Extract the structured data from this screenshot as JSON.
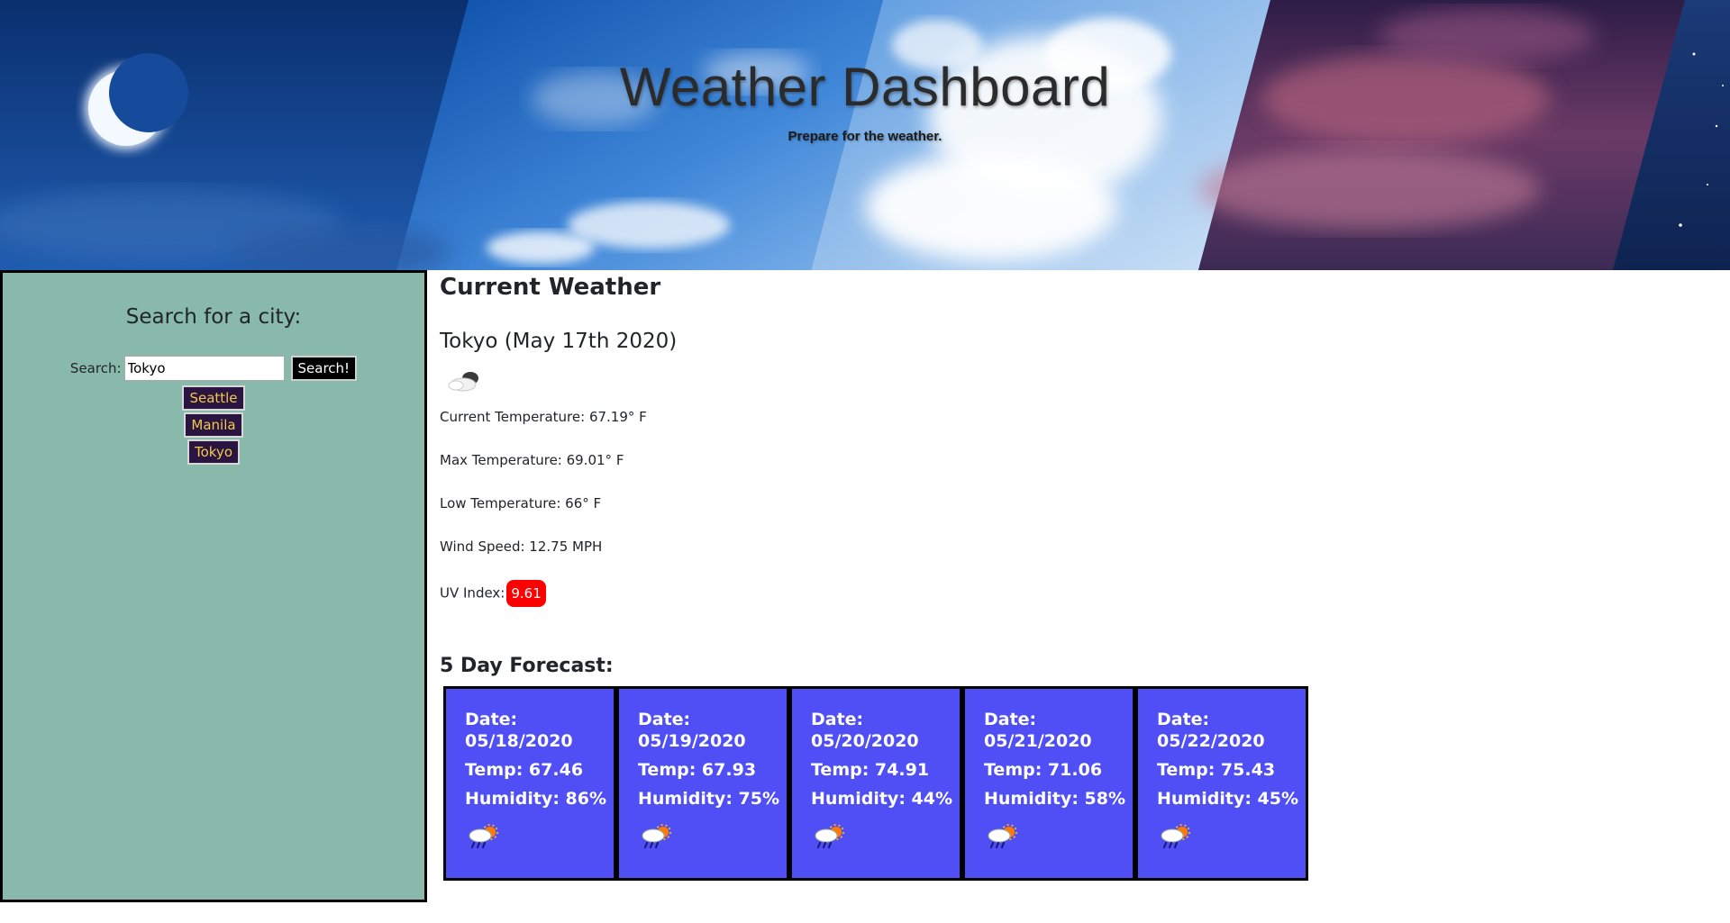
{
  "header": {
    "title": "Weather Dashboard",
    "subtitle": "Prepare for the weather."
  },
  "sidebar": {
    "title": "Search for a city:",
    "search_label": "Search:",
    "search_value": "Tokyo",
    "search_button": "Search!",
    "history": [
      "Seattle",
      "Manila",
      "Tokyo"
    ]
  },
  "current": {
    "heading": "Current Weather",
    "city": "Tokyo (May 17th 2020)",
    "icon": "cloud-icon",
    "temp": "Current Temperature: 67.19° F",
    "max": "Max Temperature: 69.01° F",
    "low": "Low Temperature: 66° F",
    "wind": "Wind Speed: 12.75 MPH",
    "uv_label": "UV Index:",
    "uv_value": "9.61"
  },
  "forecast": {
    "heading": "5 Day Forecast:",
    "date_label": "Date:",
    "days": [
      {
        "date": "05/18/2020",
        "temp": "Temp: 67.46",
        "humidity": "Humidity: 86%",
        "icon": "rain-sun-icon"
      },
      {
        "date": "05/19/2020",
        "temp": "Temp: 67.93",
        "humidity": "Humidity: 75%",
        "icon": "rain-sun-icon"
      },
      {
        "date": "05/20/2020",
        "temp": "Temp: 74.91",
        "humidity": "Humidity: 44%",
        "icon": "rain-sun-icon"
      },
      {
        "date": "05/21/2020",
        "temp": "Temp: 71.06",
        "humidity": "Humidity: 58%",
        "icon": "rain-sun-icon"
      },
      {
        "date": "05/22/2020",
        "temp": "Temp: 75.43",
        "humidity": "Humidity: 45%",
        "icon": "rain-sun-icon"
      }
    ]
  },
  "colors": {
    "sidebar_bg": "#88b9aa",
    "card_bg": "#4f4ff5",
    "uv_bg": "#ff0000",
    "history_bg": "#2a1440",
    "history_text": "#f2c94c"
  }
}
